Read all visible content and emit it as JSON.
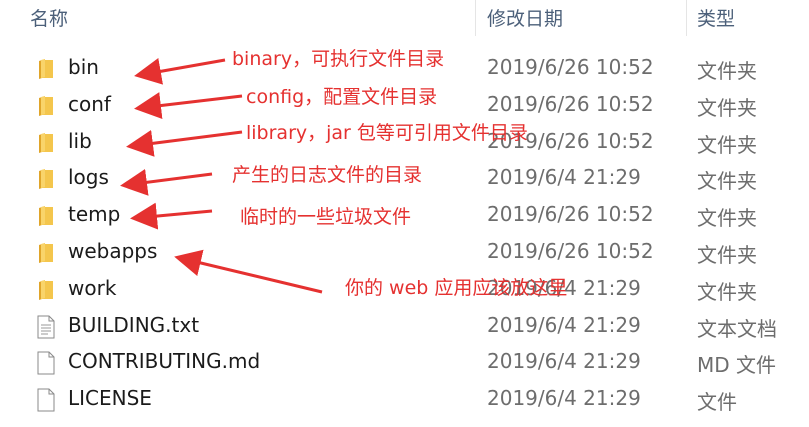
{
  "columns": {
    "name": "名称",
    "date": "修改日期",
    "type": "类型"
  },
  "files": [
    {
      "name": "bin",
      "date": "2019/6/26 10:52",
      "type": "文件夹",
      "icon": "folder-icon"
    },
    {
      "name": "conf",
      "date": "2019/6/26 10:52",
      "type": "文件夹",
      "icon": "folder-icon"
    },
    {
      "name": "lib",
      "date": "2019/6/26 10:52",
      "type": "文件夹",
      "icon": "folder-icon"
    },
    {
      "name": "logs",
      "date": "2019/6/4 21:29",
      "type": "文件夹",
      "icon": "folder-icon"
    },
    {
      "name": "temp",
      "date": "2019/6/26 10:52",
      "type": "文件夹",
      "icon": "folder-icon"
    },
    {
      "name": "webapps",
      "date": "2019/6/26 10:52",
      "type": "文件夹",
      "icon": "folder-icon"
    },
    {
      "name": "work",
      "date": "2019/6/4 21:29",
      "type": "文件夹",
      "icon": "folder-icon"
    },
    {
      "name": "BUILDING.txt",
      "date": "2019/6/4 21:29",
      "type": "文本文档",
      "icon": "text-file-icon"
    },
    {
      "name": "CONTRIBUTING.md",
      "date": "2019/6/4 21:29",
      "type": "MD 文件",
      "icon": "document-file-icon"
    },
    {
      "name": "LICENSE",
      "date": "2019/6/4 21:29",
      "type": "文件",
      "icon": "document-file-icon"
    }
  ],
  "annotations": [
    {
      "text": "binary，可执行文件目录"
    },
    {
      "text": "config，配置文件目录"
    },
    {
      "text": "library，jar 包等可引用文件目录"
    },
    {
      "text": "产生的日志文件的目录"
    },
    {
      "text": "临时的一些垃圾文件"
    },
    {
      "text": "你的 web 应用应该放这里"
    }
  ],
  "colors": {
    "annotation": "#e53130",
    "folder": "#f4c64d",
    "header_text": "#4c607a"
  }
}
